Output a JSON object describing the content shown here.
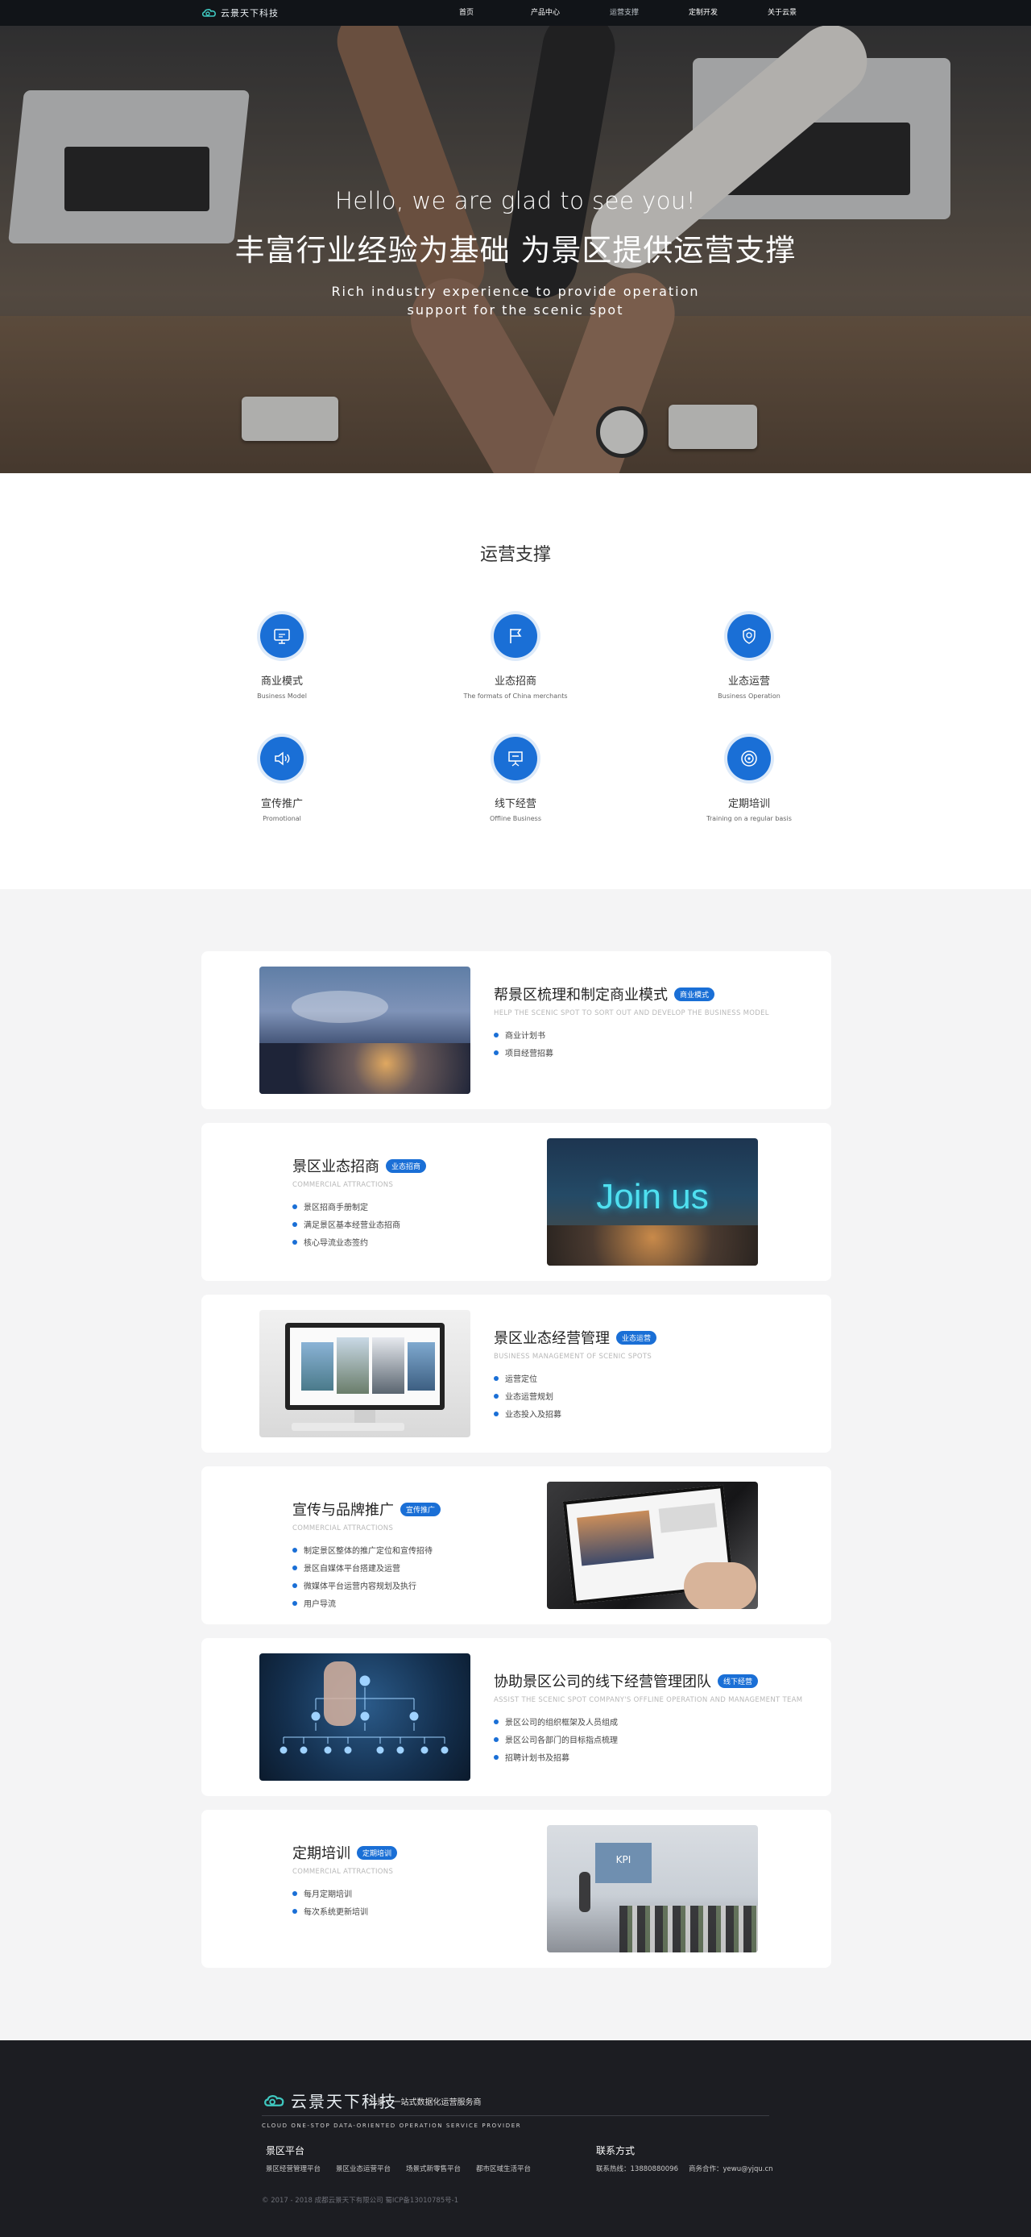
{
  "nav": {
    "logo": "云景天下科技",
    "items": [
      {
        "label": "首页",
        "active": false
      },
      {
        "label": "产品中心",
        "active": false
      },
      {
        "label": "运营支撑",
        "active": true
      },
      {
        "label": "定制开发",
        "active": false
      },
      {
        "label": "关于云景",
        "active": false
      }
    ]
  },
  "hero": {
    "hello": "Hello, we are glad to see you!",
    "title": "丰富行业经验为基础 为景区提供运营支撑",
    "subtitle_line1": "Rich industry experience to provide operation",
    "subtitle_line2": "support for the scenic spot"
  },
  "operations": {
    "title": "运营支撑",
    "items": [
      {
        "name": "商业模式",
        "en": "Business Model",
        "icon": "monitor-chat-icon"
      },
      {
        "name": "业态招商",
        "en": "The formats of China merchants",
        "icon": "flag-icon"
      },
      {
        "name": "业态运营",
        "en": "Business Operation",
        "icon": "shield-icon"
      },
      {
        "name": "宣传推广",
        "en": "Promotional",
        "icon": "speaker-icon"
      },
      {
        "name": "线下经营",
        "en": "Offline Business",
        "icon": "presentation-icon"
      },
      {
        "name": "定期培训",
        "en": "Training on a regular basis",
        "icon": "target-icon"
      }
    ]
  },
  "cards": [
    {
      "title": "帮景区梳理和制定商业模式",
      "tag": "商业模式",
      "en": "HELP THE SCENIC SPOT TO SORT OUT AND DEVELOP THE BUSINESS MODEL",
      "bullets": [
        "商业计划书",
        "项目经营招募"
      ],
      "image": "city-night-image"
    },
    {
      "title": "景区业态招商",
      "tag": "业态招商",
      "en": "COMMERCIAL ATTRACTIONS",
      "bullets": [
        "景区招商手册制定",
        "满足景区基本经营业态招商",
        "核心导流业态签约"
      ],
      "image": "join-us-image",
      "join_text": "Join us"
    },
    {
      "title": "景区业态经营管理",
      "tag": "业态运营",
      "en": "BUSINESS MANAGEMENT OF SCENIC SPOTS",
      "bullets": [
        "运营定位",
        "业态运营规划",
        "业态投入及招募"
      ],
      "image": "imac-image"
    },
    {
      "title": "宣传与品牌推广",
      "tag": "宣传推广",
      "en": "COMMERCIAL ATTRACTIONS",
      "bullets": [
        "制定景区整体的推广定位和宣传招待",
        "景区自媒体平台搭建及运营",
        "微媒体平台运营内容规划及执行",
        "用户导流"
      ],
      "image": "tablet-image"
    },
    {
      "title": "协助景区公司的线下经营管理团队",
      "tag": "线下经营",
      "en": "ASSIST THE SCENIC SPOT COMPANY'S OFFLINE OPERATION AND MANAGEMENT TEAM",
      "bullets": [
        "景区公司的组织框架及人员组成",
        "景区公司各部门的目标指点梳理",
        "招聘计划书及招募"
      ],
      "image": "org-chart-image"
    },
    {
      "title": "定期培训",
      "tag": "定期培训",
      "en": "COMMERCIAL ATTRACTIONS",
      "bullets": [
        "每月定期培训",
        "每次系统更新培训"
      ],
      "image": "training-image",
      "kpi_text": "KPI"
    }
  ],
  "footer": {
    "logo": "云景天下科技",
    "slogan": "云景 · 一站式数据化运营服务商",
    "en": "CLOUD ONE-STOP DATA-ORIENTED OPERATION SERVICE PROVIDER",
    "platform_title": "景区平台",
    "platform_links": [
      "景区经营管理平台",
      "景区业态运营平台",
      "场景式新零售平台",
      "都市区域生活平台"
    ],
    "contact_title": "联系方式",
    "hotline": "联系热线：13880880096",
    "coop": "商务合作：yewu@yjqu.cn",
    "copyright": "© 2017 - 2018  成都云景天下有限公司  蜀ICP备13010785号-1"
  }
}
